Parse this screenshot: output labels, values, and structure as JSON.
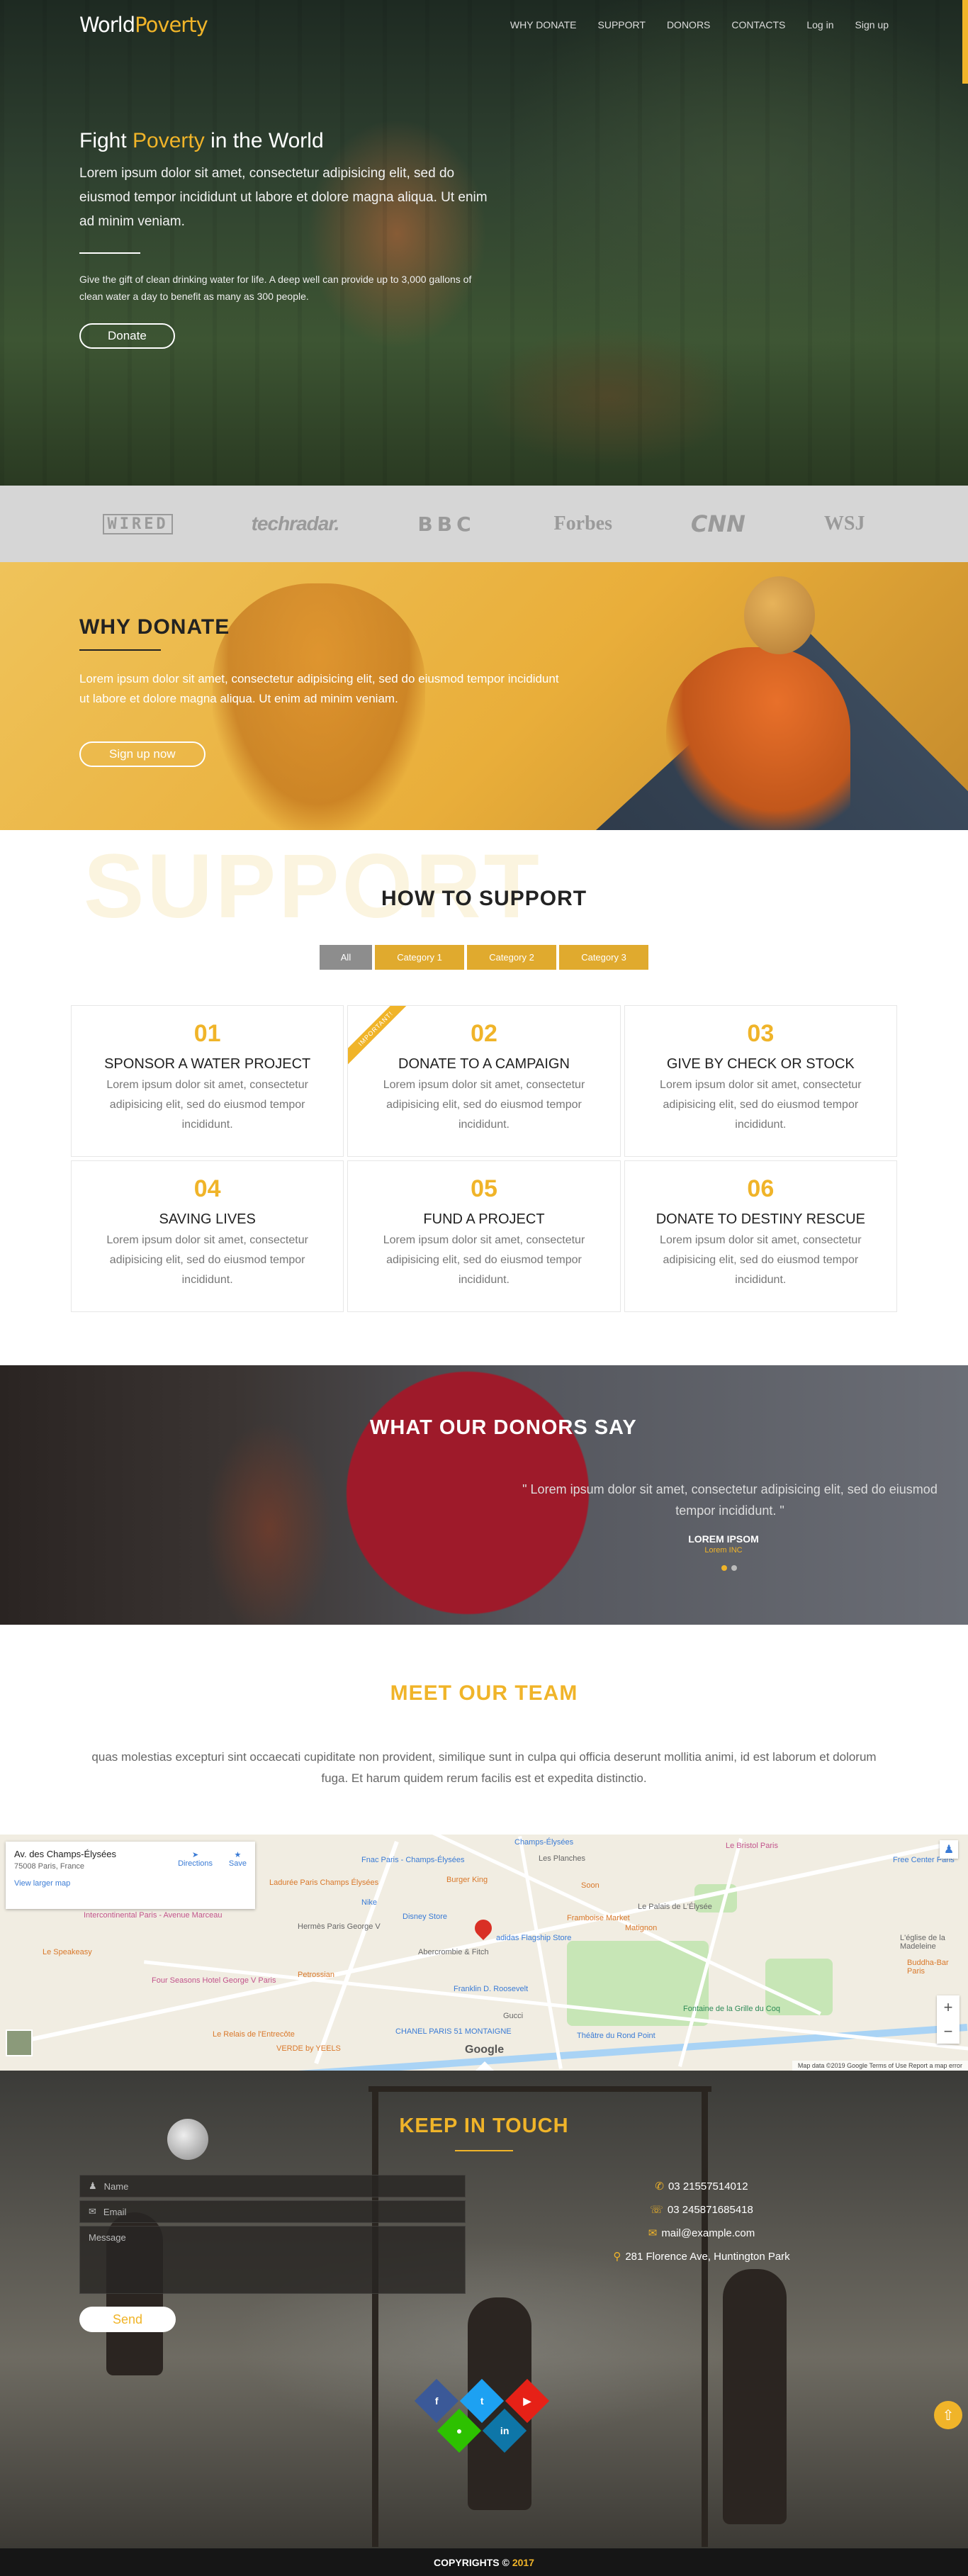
{
  "brand": {
    "logo_world": "World",
    "logo_poverty": "Poverty"
  },
  "nav": {
    "items": [
      {
        "label": "WHY DONATE"
      },
      {
        "label": "SUPPORT"
      },
      {
        "label": "DONORS"
      },
      {
        "label": "CONTACTS"
      },
      {
        "label": "Log in"
      },
      {
        "label": "Sign up"
      }
    ]
  },
  "hero": {
    "title_pre": "Fight",
    "title_accent": "Poverty",
    "title_post": "in the World",
    "subtitle": "Lorem ipsum dolor sit amet, consectetur adipisicing elit, sed do eiusmod tempor incididunt ut labore et dolore magna aliqua. Ut enim ad minim veniam.",
    "small": "Give the gift of clean drinking water for life. A deep well can provide up to 3,000 gallons of clean water a day to benefit as many as 300 people.",
    "button": "Donate"
  },
  "logos": {
    "wired": "WIRED",
    "techradar": "techradar.",
    "bbc": "BBC",
    "forbes": "Forbes",
    "cnn": "CNN",
    "wsj": "WSJ"
  },
  "why": {
    "title": "WHY DONATE",
    "desc": "Lorem ipsum dolor sit amet, consectetur adipisicing elit, sed do eiusmod tempor incididunt ut labore et dolore magna aliqua. Ut enim ad minim veniam.",
    "button": "Sign up now"
  },
  "support": {
    "bg_word": "SUPPORT",
    "title": "HOW TO SUPPORT",
    "filters": [
      "All",
      "Category 1",
      "Category 2",
      "Category 3"
    ],
    "ribbon": "IMPORTANT!",
    "cards": [
      {
        "num": "01",
        "title": "SPONSOR A WATER PROJECT",
        "text": "Lorem ipsum dolor sit amet, consectetur adipisicing elit, sed do eiusmod tempor incididunt."
      },
      {
        "num": "02",
        "title": "DONATE TO A CAMPAIGN",
        "text": "Lorem ipsum dolor sit amet, consectetur adipisicing elit, sed do eiusmod tempor incididunt."
      },
      {
        "num": "03",
        "title": "GIVE BY CHECK OR STOCK",
        "text": "Lorem ipsum dolor sit amet, consectetur adipisicing elit, sed do eiusmod tempor incididunt."
      },
      {
        "num": "04",
        "title": "SAVING LIVES",
        "text": "Lorem ipsum dolor sit amet, consectetur adipisicing elit, sed do eiusmod tempor incididunt."
      },
      {
        "num": "05",
        "title": "FUND A PROJECT",
        "text": "Lorem ipsum dolor sit amet, consectetur adipisicing elit, sed do eiusmod tempor incididunt."
      },
      {
        "num": "06",
        "title": "DONATE TO DESTINY RESCUE",
        "text": "Lorem ipsum dolor sit amet, consectetur adipisicing elit, sed do eiusmod tempor incididunt."
      }
    ]
  },
  "donors": {
    "title": "WHAT OUR DONORS SAY",
    "quote": "\" Lorem ipsum dolor sit amet, consectetur adipisicing elit, sed do eiusmod tempor incididunt. \"",
    "name": "LOREM IPSOM",
    "company": "Lorem INC"
  },
  "team": {
    "title": "MEET OUR TEAM",
    "text": "quas molestias excepturi sint occaecati cupiditate non provident, similique sunt in culpa qui officia deserunt mollitia animi, id est laborum et dolorum fuga. Et harum quidem rerum facilis est et expedita distinctio."
  },
  "map": {
    "place": "Av. des Champs-Élysées",
    "address": "75008 Paris, France",
    "larger": "View larger map",
    "directions": "Directions",
    "save": "Save",
    "google": "Google",
    "footer": "Map data ©2019 Google   Terms of Use   Report a map error",
    "pois": {
      "champs": "Champs-Élysées",
      "planches": "Les Planches",
      "bristol": "Le Bristol Paris",
      "fnac": "Fnac Paris - Champs-Élysées",
      "burger": "Burger King",
      "intercontinental": "Intercontinental Paris - Avenue Marceau",
      "hermes": "Hermès Paris George V",
      "disney": "Disney Store",
      "adidas": "adidas Flagship Store",
      "abercrombie": "Abercrombie & Fitch",
      "four_seasons": "Four Seasons Hotel George V Paris",
      "petrossian": "Petrossian",
      "roosevelt": "Franklin D. Roosevelt",
      "chanel": "CHANEL PARIS 51 MONTAIGNE",
      "gucci": "Gucci",
      "theatre": "Théâtre du Rond Point",
      "fontaine": "Fontaine de la Grille du Coq",
      "palais": "Le Palais de L'Élysée",
      "freecenter": "Free Center Paris",
      "buddha": "Buddha-Bar Paris",
      "vitruve": "Le Speakeasy",
      "yeels": "VERDE by YEELS",
      "ladurée": "Ladurée Paris Champs Élysées",
      "nike": "Nike",
      "frame": "Framboise Market",
      "matignon": "Matignon",
      "soon": "Soon",
      "madeleine": "L'église de la Madeleine",
      "relais": "Le Relais de l'Entrecôte"
    }
  },
  "contact": {
    "title": "KEEP IN TOUCH",
    "name_ph": "Name",
    "email_ph": "Email",
    "message_ph": "Message",
    "send": "Send",
    "phone1": "03 21557514012",
    "phone2": "03 245871685418",
    "email": "mail@example.com",
    "address": "281 Florence Ave, Huntington Park"
  },
  "footer": {
    "copy": "COPYRIGHTS ©",
    "year": "2017"
  },
  "colors": {
    "accent": "#f0b429",
    "facebook": "#3b5998",
    "twitter": "#1da1f2",
    "youtube": "#e62117",
    "wechat": "#2dc100",
    "linkedin": "#0e76a8"
  }
}
